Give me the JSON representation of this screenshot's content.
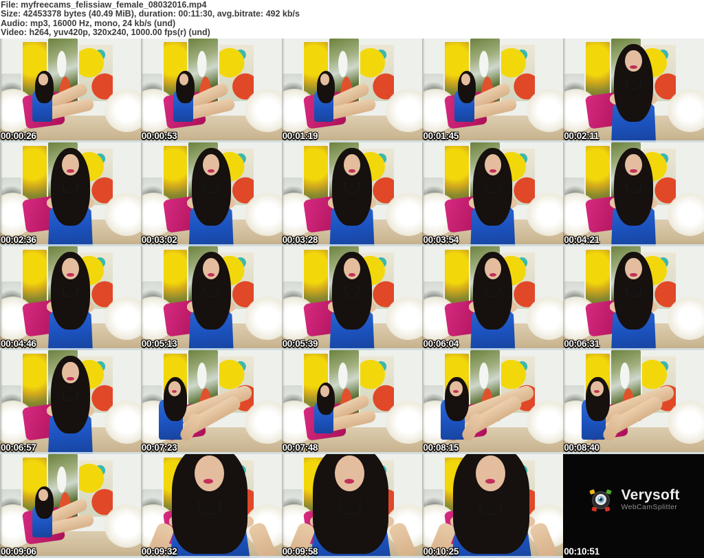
{
  "header": {
    "file_line": "File: myfreecams_felissiaw_female_08032016.mp4",
    "size_line": "Size: 42453378 bytes (40.49 MiB), duration: 00:11:30, avg.bitrate: 492 kb/s",
    "audio_line": "Audio: mp3, 16000 Hz, mono, 24 kb/s (und)",
    "video_line": "Video: h264, yuv420p, 320x240, 1000.00 fps(r) (und)"
  },
  "grid": {
    "columns": 5,
    "rows": 5
  },
  "thumbnails": [
    {
      "time": "00:00:26",
      "variant": "wide"
    },
    {
      "time": "00:00:53",
      "variant": "wide"
    },
    {
      "time": "00:01:19",
      "variant": "wide"
    },
    {
      "time": "00:01:45",
      "variant": "wide"
    },
    {
      "time": "00:02:11",
      "variant": "medium"
    },
    {
      "time": "00:02:36",
      "variant": "medium"
    },
    {
      "time": "00:03:02",
      "variant": "medium"
    },
    {
      "time": "00:03:28",
      "variant": "medium"
    },
    {
      "time": "00:03:54",
      "variant": "medium"
    },
    {
      "time": "00:04:21",
      "variant": "medium"
    },
    {
      "time": "00:04:46",
      "variant": "medium"
    },
    {
      "time": "00:05:13",
      "variant": "medium"
    },
    {
      "time": "00:05:39",
      "variant": "medium"
    },
    {
      "time": "00:06:04",
      "variant": "medium"
    },
    {
      "time": "00:06:31",
      "variant": "medium"
    },
    {
      "time": "00:06:57",
      "variant": "medium"
    },
    {
      "time": "00:07:23",
      "variant": "legs"
    },
    {
      "time": "00:07:48",
      "variant": "wide"
    },
    {
      "time": "00:08:15",
      "variant": "legs"
    },
    {
      "time": "00:08:40",
      "variant": "legs"
    },
    {
      "time": "00:09:06",
      "variant": "wide"
    },
    {
      "time": "00:09:32",
      "variant": "closeup"
    },
    {
      "time": "00:09:58",
      "variant": "closeup"
    },
    {
      "time": "00:10:25",
      "variant": "closeup"
    },
    {
      "time": "00:10:51",
      "variant": "logo"
    }
  ],
  "logo_frame": {
    "brand": "Verysoft",
    "product": "WebCamSplitter"
  },
  "colors": {
    "header_text": "#3b3b3b",
    "dress_blue": "#2158c4",
    "pillow_magenta": "#c21a6e",
    "floor_beige": "#cdb995",
    "wall_white": "#eef0ec",
    "tulip_yellow": "#f2d70b",
    "tulip_red": "#e04828",
    "end_frame_black": "#060606"
  }
}
